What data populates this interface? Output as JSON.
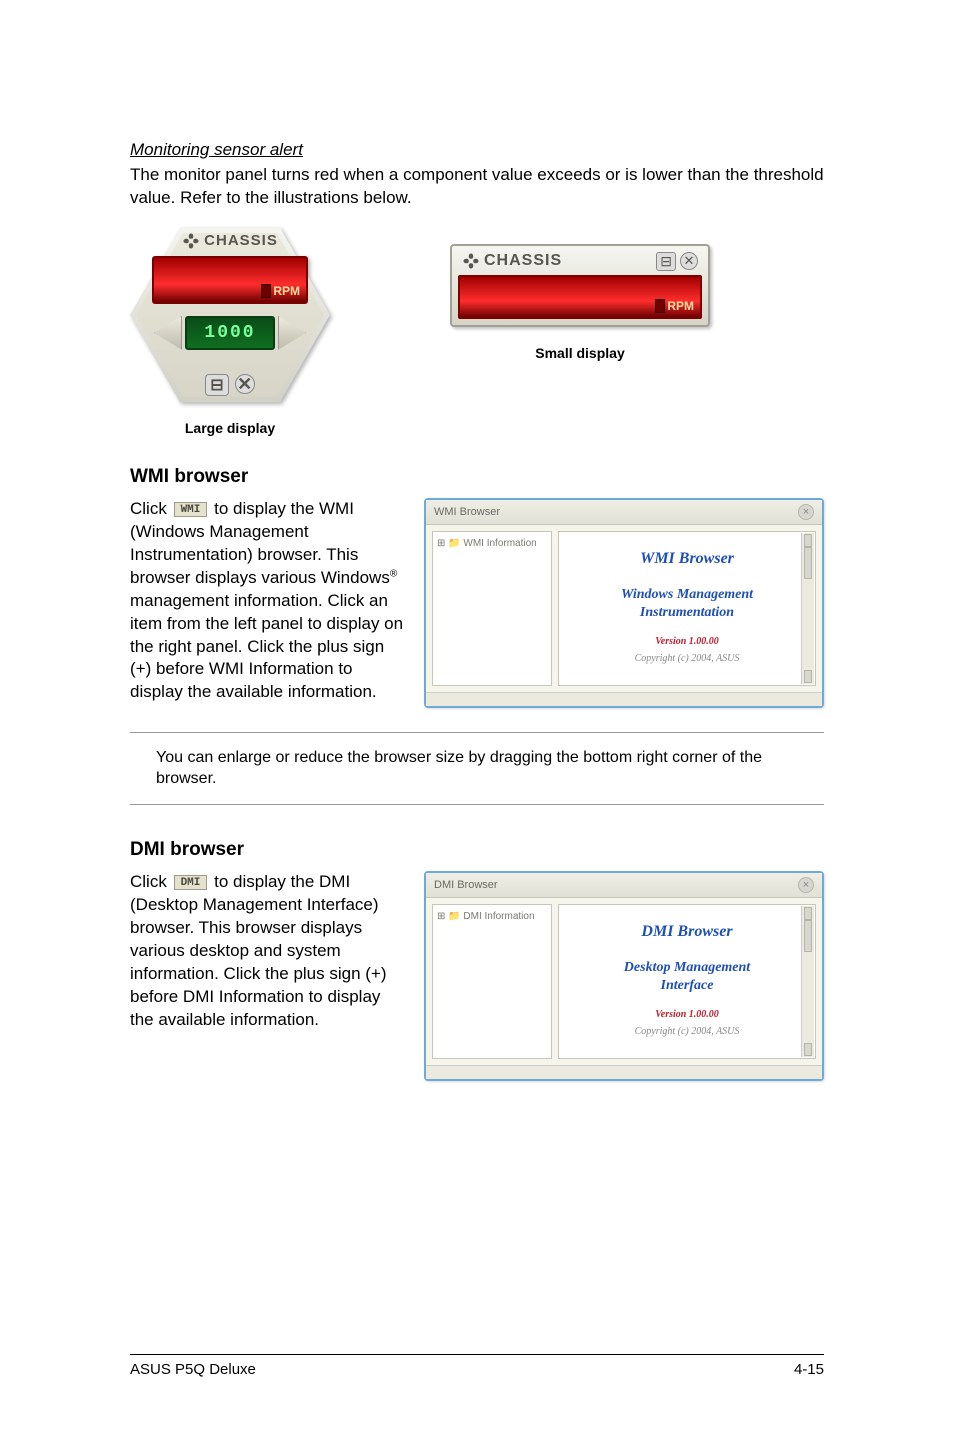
{
  "sensor": {
    "heading": "Monitoring sensor alert",
    "text": "The monitor panel turns red when a component value exceeds or is lower than the threshold value. Refer to the illustrations below."
  },
  "displays": {
    "chassis_label": "CHASSIS",
    "rpm_label": "RPM",
    "temp_value": "1000",
    "large_caption": "Large display",
    "small_caption": "Small display"
  },
  "wmi": {
    "title": "WMI browser",
    "button_label": "WMI",
    "para_before": "Click ",
    "para_after_1": " to display the WMI (Windows Management Instrumentation) browser. This browser displays various Windows",
    "reg": "®",
    "para_after_2": " management information. Click an item from the left panel to display on the right panel. Click the plus sign (+) before WMI Information to display the available information.",
    "win_title": "WMI Browser",
    "tree_label": "WMI Information",
    "content_h1": "WMI  Browser",
    "content_h2a": "Windows Management",
    "content_h2b": "Instrumentation",
    "content_ver": "Version 1.00.00",
    "content_cpy": "Copyright (c) 2004,  ASUS"
  },
  "note": {
    "text": "You can enlarge or reduce the browser size by dragging the bottom right corner of the browser."
  },
  "dmi": {
    "title": "DMI browser",
    "button_label": "DMI",
    "para_before": "Click ",
    "para_after": " to display the DMI (Desktop Management Interface) browser. This browser displays various desktop and system information. Click the plus sign (+) before DMI Information to display the available information.",
    "win_title": "DMI Browser",
    "tree_label": "DMI Information",
    "content_h1": "DMI  Browser",
    "content_h2a": "Desktop Management",
    "content_h2b": "Interface",
    "content_ver": "Version 1.00.00",
    "content_cpy": "Copyright (c) 2004,  ASUS"
  },
  "footer": {
    "left": "ASUS P5Q Deluxe",
    "right": "4-15"
  }
}
